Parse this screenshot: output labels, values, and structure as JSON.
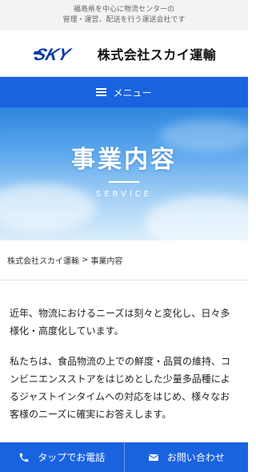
{
  "header": {
    "tagline_line1": "福島県を中心に物流センターの",
    "tagline_line2": "管理・運営、配送を行う運送会社です",
    "logo_text": "SKY",
    "company_name": "株式会社スカイ運輸"
  },
  "menu": {
    "label": "メニュー"
  },
  "hero": {
    "title": "事業内容",
    "subtitle": "SERVICE"
  },
  "breadcrumb": {
    "home": "株式会社スカイ運輸",
    "separator": ">",
    "current": "事業内容"
  },
  "content": {
    "para1": "近年、物流におけるニーズは刻々と変化し、日々多様化・高度化しています。",
    "para2": "私たちは、食品物流の上での鮮度・品質の維持、コンビニエンスストアをはじめとした少量多品種によるジャストインタイムへの対応をはじめ、様々なお客様のニーズに確実にお答えします。"
  },
  "footer": {
    "phone_label": "タップでお電話",
    "contact_label": "お問い合わせ"
  },
  "colors": {
    "brand_blue": "#1a63e0",
    "logo_blue": "#0b3aa8"
  },
  "icons": {
    "menu": "hamburger-icon",
    "phone": "phone-icon",
    "mail": "mail-icon"
  }
}
